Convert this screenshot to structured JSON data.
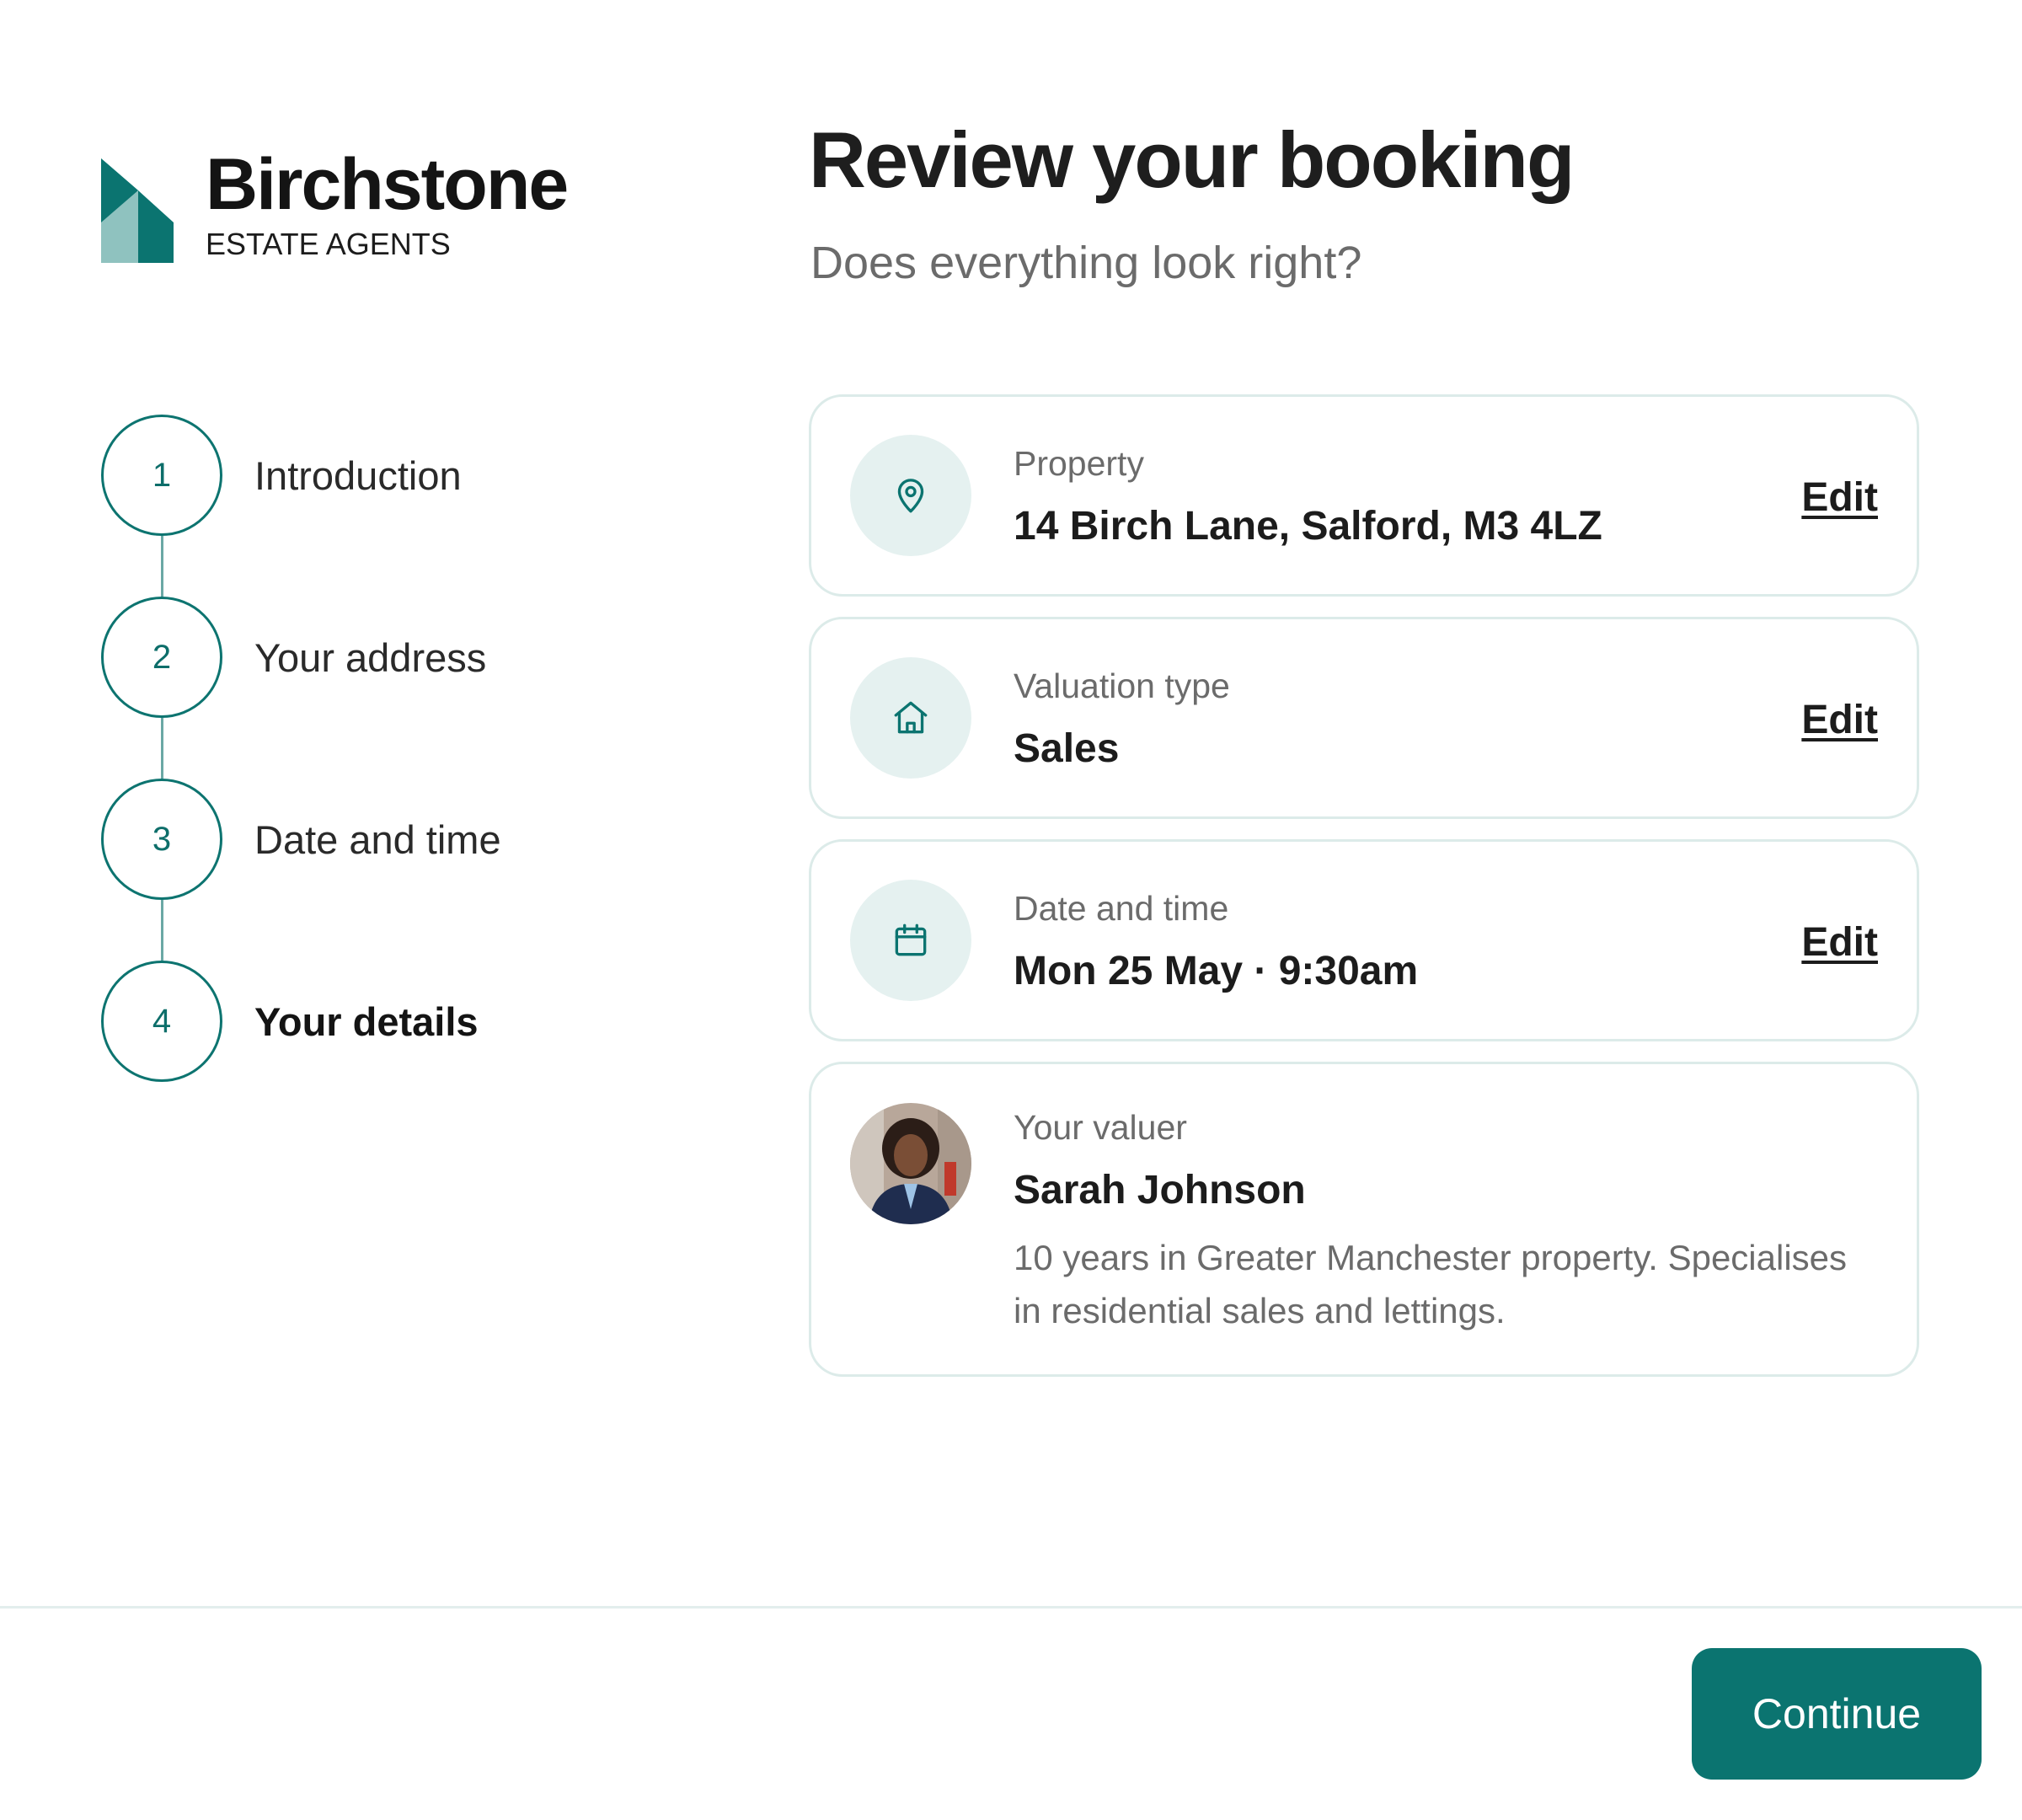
{
  "brand": {
    "name": "Birchstone",
    "tagline": "ESTATE AGENTS",
    "colors": {
      "primary": "#0b7470",
      "accent_light": "#e5f1f0",
      "logo_light": "#8fc2bf"
    }
  },
  "stepper": {
    "steps": [
      {
        "number": "1",
        "label": "Introduction"
      },
      {
        "number": "2",
        "label": "Your address"
      },
      {
        "number": "3",
        "label": "Date and time"
      },
      {
        "number": "4",
        "label": "Your details",
        "active": true
      }
    ]
  },
  "header": {
    "title": "Review your booking",
    "subtitle": "Does everything look right?"
  },
  "cards": {
    "property": {
      "icon": "map-pin-icon",
      "label": "Property",
      "value": "14 Birch Lane, Salford, M3 4LZ",
      "edit_label": "Edit"
    },
    "valuation": {
      "icon": "home-icon",
      "label": "Valuation type",
      "value": "Sales",
      "edit_label": "Edit"
    },
    "datetime": {
      "icon": "calendar-icon",
      "label": "Date and time",
      "value": "Mon 25 May · 9:30am",
      "edit_label": "Edit"
    },
    "valuer": {
      "label": "Your valuer",
      "name": "Sarah Johnson",
      "description": "10 years in Greater Manchester property. Specialises in residential sales and lettings."
    }
  },
  "footer": {
    "continue_label": "Continue"
  }
}
